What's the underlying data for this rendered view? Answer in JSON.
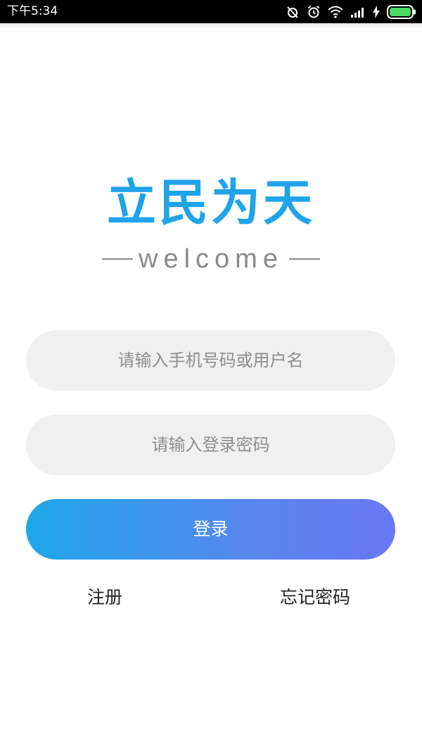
{
  "status_bar": {
    "time": "下午5:34",
    "icons": [
      "alarm-off-icon",
      "alarm-icon",
      "wifi-icon",
      "signal-icon",
      "charging-icon",
      "battery-icon"
    ],
    "battery_color": "#4cd964"
  },
  "brand": {
    "logo_text": "立民为天",
    "tagline": "welcome",
    "logo_color": "#1fa3ea"
  },
  "form": {
    "username_placeholder": "请输入手机号码或用户名",
    "username_value": "",
    "password_placeholder": "请输入登录密码",
    "password_value": "",
    "login_label": "登录",
    "gradient_start": "#1ea7ea",
    "gradient_end": "#6a78f5"
  },
  "links": {
    "register_label": "注册",
    "forgot_label": "忘记密码"
  }
}
